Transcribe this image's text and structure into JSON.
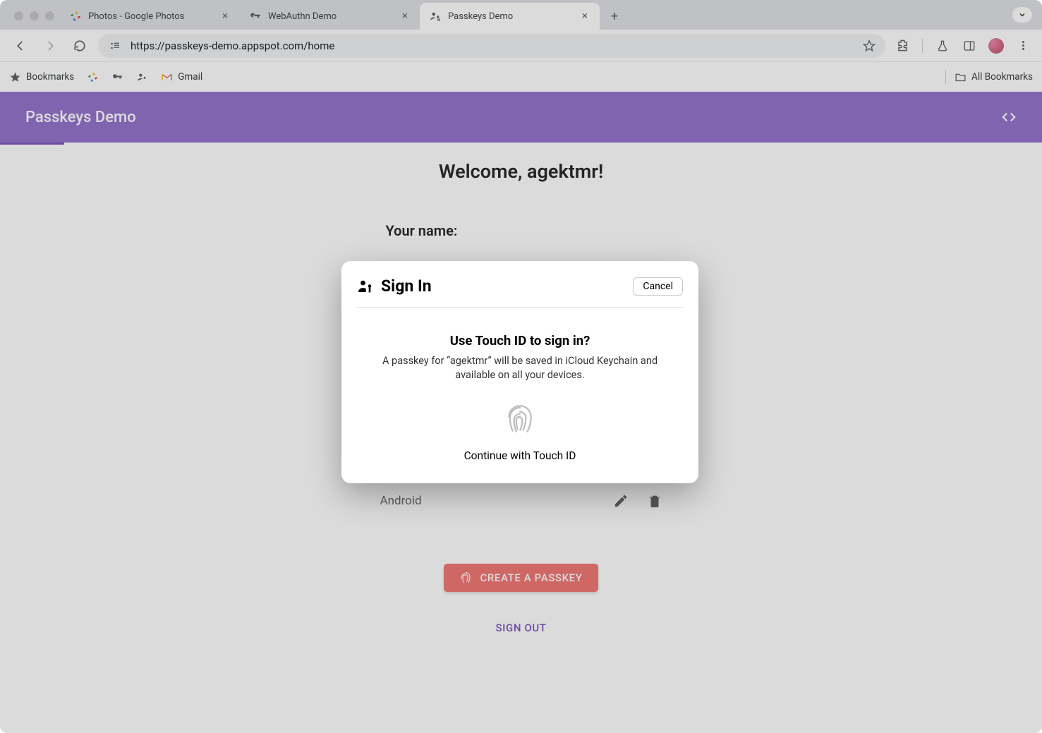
{
  "browser": {
    "tabs": [
      {
        "title": "Photos - Google Photos",
        "active": false
      },
      {
        "title": "WebAuthn Demo",
        "active": false
      },
      {
        "title": "Passkeys Demo",
        "active": true
      }
    ],
    "url": "https://passkeys-demo.appspot.com/home",
    "bookmarks_label": "Bookmarks",
    "gmail_label": "Gmail",
    "all_bookmarks_label": "All Bookmarks"
  },
  "page": {
    "header_title": "Passkeys Demo",
    "welcome": "Welcome, agektmr!",
    "name_label": "Your name:",
    "passkey_row_name": "Android",
    "create_button": "CREATE A PASSKEY",
    "sign_out": "SIGN OUT"
  },
  "dialog": {
    "title": "Sign In",
    "cancel": "Cancel",
    "heading": "Use Touch ID to sign in?",
    "body": "A passkey for “agektmr” will be saved in iCloud Keychain and available on all your devices.",
    "continue": "Continue with Touch ID"
  },
  "colors": {
    "accent": "#9575cd",
    "danger": "#ef5350"
  }
}
